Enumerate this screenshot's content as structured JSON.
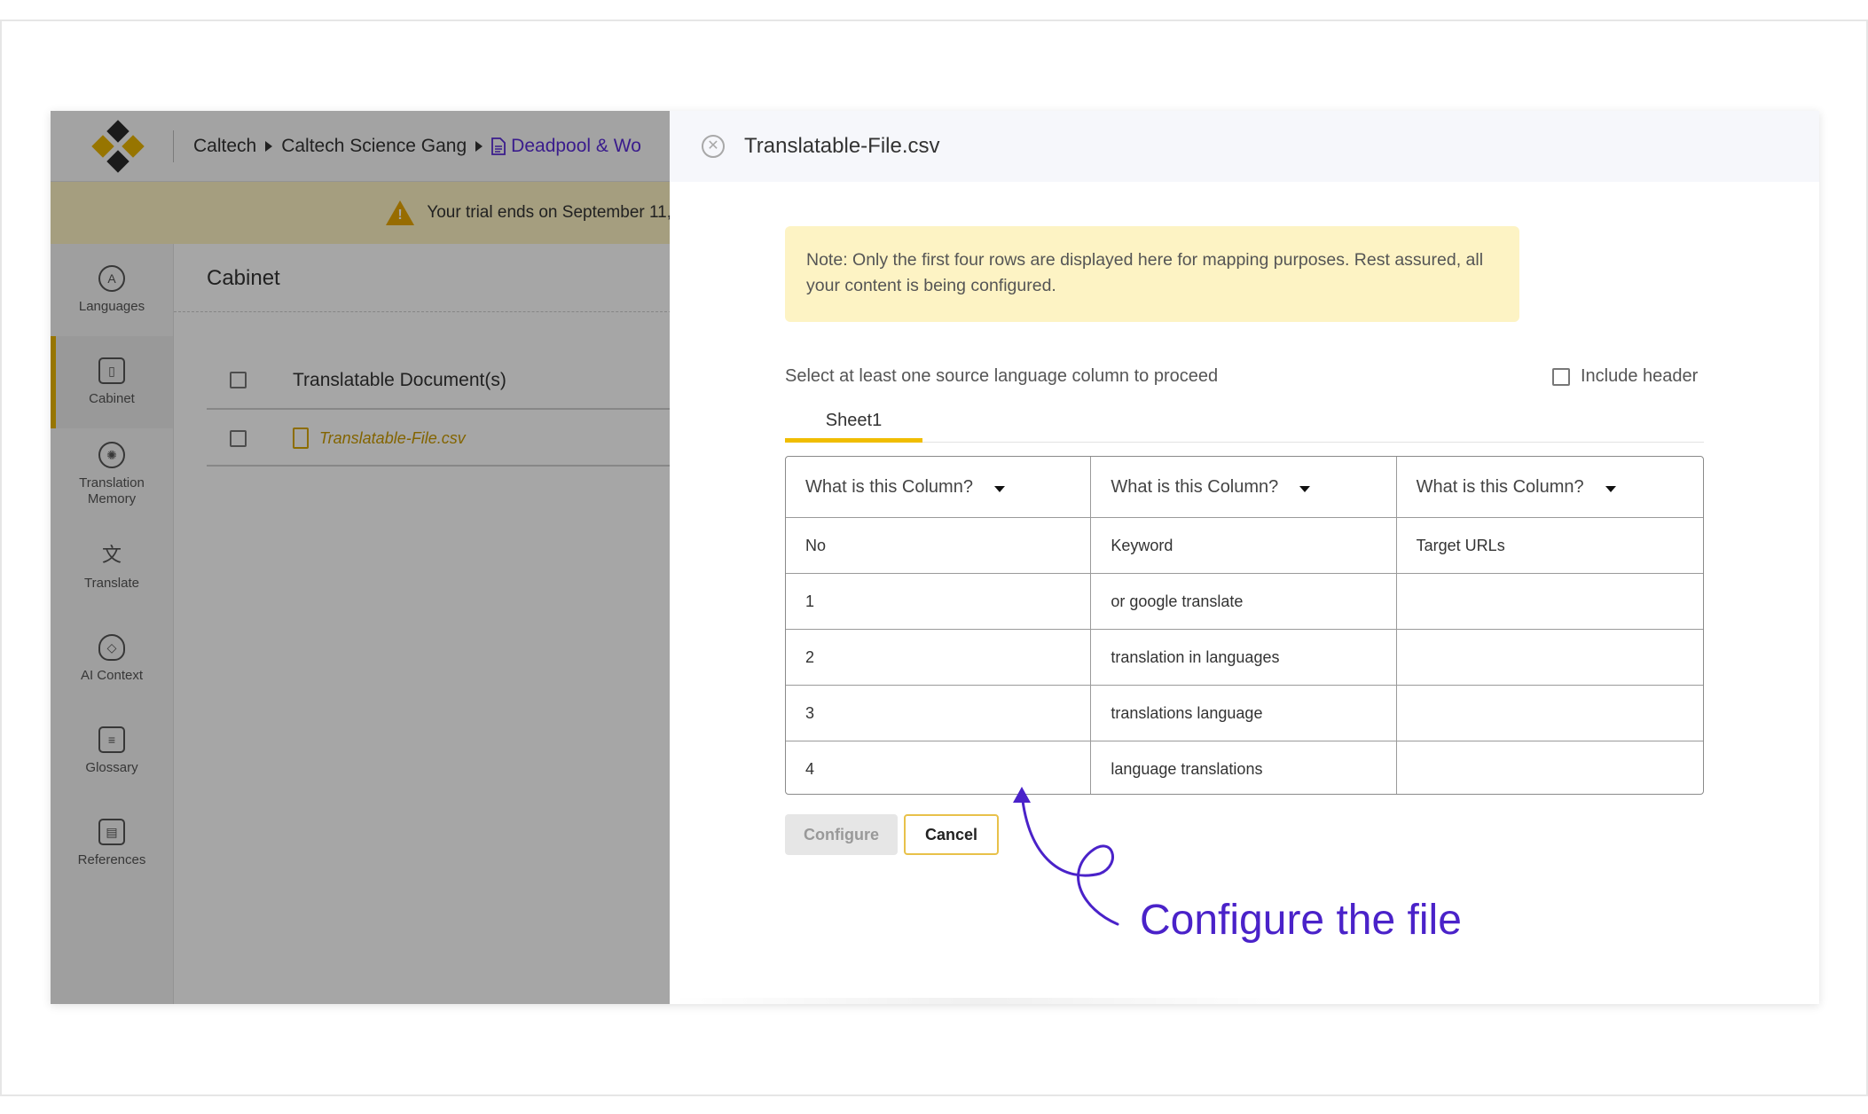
{
  "breadcrumb": {
    "org": "Caltech",
    "team": "Caltech Science Gang",
    "project": "Deadpool & Wo"
  },
  "trial": {
    "text": "Your trial ends on September 11,"
  },
  "sidebar": {
    "items": [
      {
        "label": "Languages",
        "icon": "languages-icon"
      },
      {
        "label": "Cabinet",
        "icon": "cabinet-icon"
      },
      {
        "label": "Translation Memory",
        "icon": "brain-icon"
      },
      {
        "label": "Translate",
        "icon": "translate-icon"
      },
      {
        "label": "AI Context",
        "icon": "lightbulb-icon"
      },
      {
        "label": "Glossary",
        "icon": "glossary-icon"
      },
      {
        "label": "References",
        "icon": "book-icon"
      }
    ]
  },
  "cabinet": {
    "title": "Cabinet",
    "column_header": "Translatable Document(s)",
    "file": "Translatable-File.csv"
  },
  "modal": {
    "title": "Translatable-File.csv",
    "note": "Note: Only the first four rows are displayed here for mapping purposes. Rest assured, all your content is being configured.",
    "instruction": "Select at least one source language column to proceed",
    "include_header": "Include header",
    "tab": "Sheet1",
    "column_select": "What is this Column?",
    "rows": [
      [
        "No",
        "Keyword",
        "Target URLs"
      ],
      [
        "1",
        "or google translate",
        ""
      ],
      [
        "2",
        "translation in languages",
        ""
      ],
      [
        "3",
        "translations language",
        ""
      ],
      [
        "4",
        "language translations",
        ""
      ]
    ],
    "configure_label": "Configure",
    "cancel_label": "Cancel"
  },
  "annotation": {
    "text": "Configure the file"
  },
  "colors": {
    "accent": "#f0bd00",
    "annotation": "#4a22c9",
    "link": "#5a2bd8"
  }
}
